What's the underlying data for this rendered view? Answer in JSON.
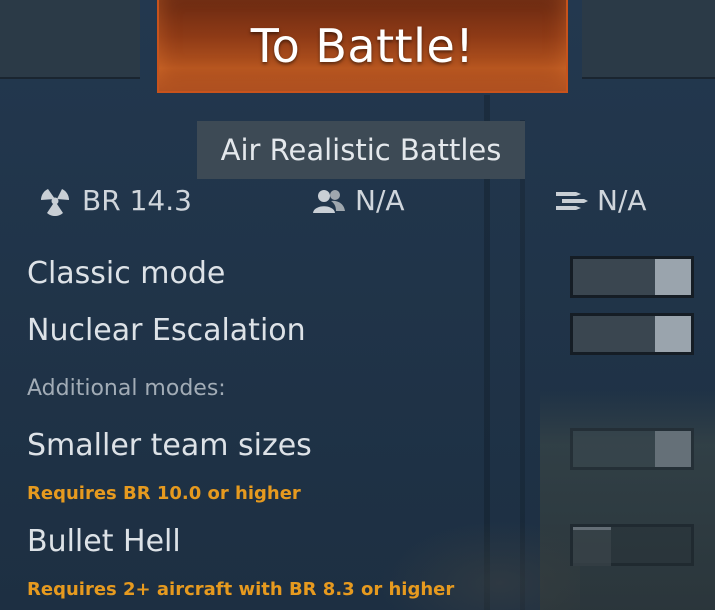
{
  "header": {
    "battle_button": "To Battle!"
  },
  "mode": {
    "label": "Air Realistic Battles"
  },
  "stats": {
    "br": "BR 14.3",
    "players": "N/A",
    "queue": "N/A"
  },
  "options": {
    "classic_mode": {
      "label": "Classic mode",
      "enabled": true
    },
    "nuclear_escalation": {
      "label": "Nuclear Escalation",
      "enabled": true
    },
    "additional_label": "Additional modes:",
    "smaller_team_sizes": {
      "label": "Smaller team sizes",
      "requirement": "Requires BR 10.0 or higher",
      "enabled": true
    },
    "bullet_hell": {
      "label": "Bullet Hell",
      "requirement": "Requires 2+ aircraft with BR 8.3 or higher",
      "enabled": false
    }
  },
  "colors": {
    "accent": "#c8531c",
    "requirement": "#e69a1f"
  },
  "icons": {
    "br": "nuclear-icon",
    "players": "players-icon",
    "queue": "queue-icon"
  }
}
